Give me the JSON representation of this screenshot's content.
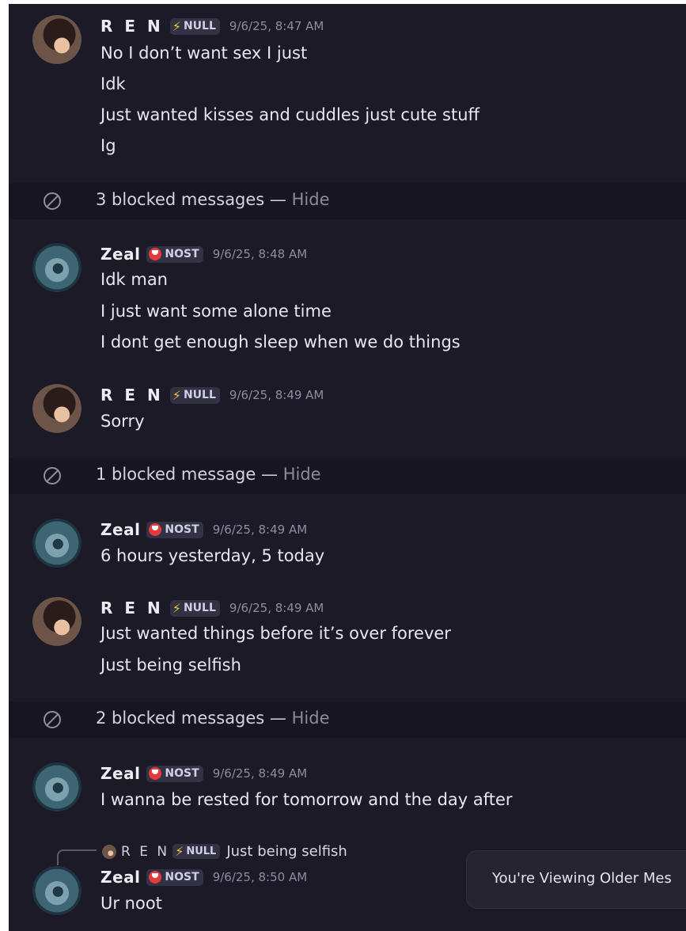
{
  "messages": [
    {
      "author": "R E N",
      "tag_icon": "lightning-bolt",
      "tag": "NULL",
      "timestamp": "9/6/25, 8:47 AM",
      "lines": [
        "No I don’t want sex I just",
        "Idk",
        "Just wanted kisses and cuddles just cute stuff",
        "Ig"
      ]
    },
    {
      "blocked": "3 blocked messages —",
      "hide": "Hide"
    },
    {
      "author": "Zeal",
      "tag_icon": "red-smile-badge",
      "tag": "NOST",
      "timestamp": "9/6/25, 8:48 AM",
      "lines": [
        "Idk man",
        "I just want some alone time",
        "I dont get enough sleep when we do things"
      ]
    },
    {
      "author": "R E N",
      "tag_icon": "lightning-bolt",
      "tag": "NULL",
      "timestamp": "9/6/25, 8:49 AM",
      "lines": [
        "Sorry"
      ]
    },
    {
      "blocked": "1 blocked message —",
      "hide": "Hide"
    },
    {
      "author": "Zeal",
      "tag_icon": "red-smile-badge",
      "tag": "NOST",
      "timestamp": "9/6/25, 8:49 AM",
      "lines": [
        "6 hours yesterday, 5 today"
      ]
    },
    {
      "author": "R E N",
      "tag_icon": "lightning-bolt",
      "tag": "NULL",
      "timestamp": "9/6/25, 8:49 AM",
      "lines": [
        "Just wanted things before it’s over forever",
        "Just being selfish"
      ]
    },
    {
      "blocked": "2 blocked messages —",
      "hide": "Hide"
    },
    {
      "author": "Zeal",
      "tag_icon": "red-smile-badge",
      "tag": "NOST",
      "timestamp": "9/6/25, 8:49 AM",
      "lines": [
        "I wanna be rested for tomorrow and the day after"
      ]
    },
    {
      "reply_to": {
        "author": "R E N",
        "tag": "NULL",
        "text": "Just being selfish"
      },
      "author": "Zeal",
      "tag_icon": "red-smile-badge",
      "tag": "NOST",
      "timestamp": "9/6/25, 8:50 AM",
      "lines": [
        "Ur noot"
      ]
    }
  ],
  "toast": {
    "text": "You're Viewing Older Mes"
  },
  "colors": {
    "background": "#1b1a26",
    "blocked_row": "#171620",
    "text": "#e8e7f0",
    "muted": "#8d8ca3",
    "null_bolt": "#f3c52a",
    "nost_badge": "#e23b3b"
  }
}
